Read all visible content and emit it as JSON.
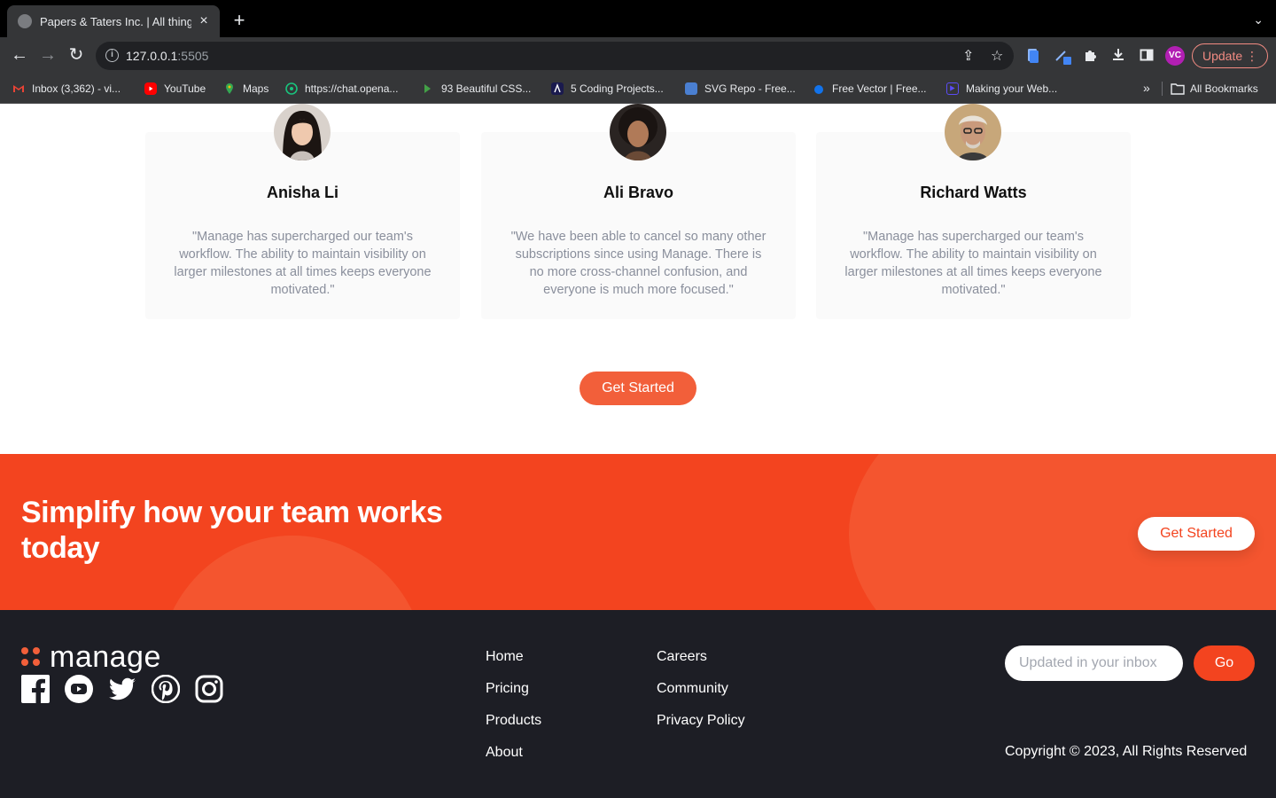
{
  "browser": {
    "tab_title": "Papers & Taters Inc. | All things",
    "url_host": "127.0.0.1",
    "url_port": ":5505",
    "profile_initials": "VC",
    "update_label": "Update",
    "bookmarks": [
      {
        "label": "Inbox (3,362) - vi...",
        "icon": "gmail-icon",
        "color": "#ea4335"
      },
      {
        "label": "YouTube",
        "icon": "youtube-icon",
        "color": "#ff0000"
      },
      {
        "label": "Maps",
        "icon": "maps-icon",
        "color": "#34a853"
      },
      {
        "label": "https://chat.opena...",
        "icon": "openai-icon",
        "color": "#19c37d"
      },
      {
        "label": "93 Beautiful CSS...",
        "icon": "css-icon",
        "color": "#2e7d32"
      },
      {
        "label": "5 Coding Projects...",
        "icon": "code-icon",
        "color": "#1a1a4e"
      },
      {
        "label": "SVG Repo - Free...",
        "icon": "svgrepo-icon",
        "color": "#4a7fd1"
      },
      {
        "label": "Free Vector | Free...",
        "icon": "freepik-icon",
        "color": "#1273eb"
      },
      {
        "label": "Making your Web...",
        "icon": "play-icon",
        "color": "#5b4cf5"
      }
    ],
    "all_bookmarks_label": "All Bookmarks"
  },
  "testimonials": [
    {
      "name": "Anisha Li",
      "quote": "\"Manage has supercharged our team's workflow. The ability to maintain visibility on larger milestones at all times keeps everyone motivated.\""
    },
    {
      "name": "Ali Bravo",
      "quote": "\"We have been able to cancel so many other subscriptions since using Manage. There is no more cross-channel confusion, and everyone is much more focused.\""
    },
    {
      "name": "Richard Watts",
      "quote": "\"Manage has supercharged our team's workflow. The ability to maintain visibility on larger milestones at all times keeps everyone motivated.\""
    }
  ],
  "get_started_label": "Get Started",
  "cta": {
    "title": "Simplify how your team works today",
    "button_label": "Get Started"
  },
  "footer": {
    "logo_text": "manage",
    "links_col1": [
      "Home",
      "Pricing",
      "Products",
      "About"
    ],
    "links_col2": [
      "Careers",
      "Community",
      "Privacy Policy"
    ],
    "newsletter_placeholder": "Updated in your inbox",
    "go_label": "Go",
    "copyright": "Copyright © 2023, All Rights Reserved"
  },
  "colors": {
    "accent": "#f3441f",
    "footer_bg": "#1d1e25"
  }
}
